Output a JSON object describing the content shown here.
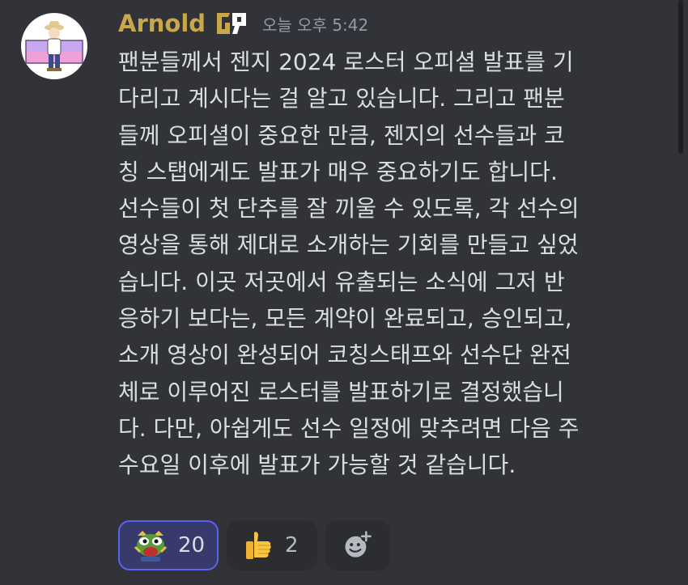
{
  "author": {
    "name": "Arnold",
    "badge_icon": "gen-g-badge-icon",
    "timestamp": "오늘 오후 5:42"
  },
  "message": {
    "lines": [
      "팬분들께서 젠지 2024 로스터 오피셜 발표를 기",
      "다리고 계시다는 걸 알고 있습니다. 그리고 팬분",
      "들께 오피셜이 중요한 만큼, 젠지의 선수들과 코",
      "칭 스탭에게도 발표가 매우 중요하기도 합니다.",
      "선수들이 첫 단추를 잘 끼울 수 있도록, 각 선수의",
      "영상을 통해 제대로 소개하는 기회를 만들고 싶었",
      "습니다. 이곳 저곳에서 유출되는 소식에 그저 반",
      "응하기 보다는, 모든 계약이 완료되고, 승인되고,",
      "소개 영상이 완성되어 코칭스태프와 선수단 완전",
      "체로 이루어진 로스터를 발표하기로 결정했습니",
      "다. 다만, 아쉽게도 선수 일정에 맞추려면 다음 주",
      "수요일 이후에 발표가 가능할 것 같습니다."
    ]
  },
  "reactions": [
    {
      "emoji_icon": "pepe-cheer-icon",
      "count": "20",
      "active": true
    },
    {
      "emoji_icon": "thumbs-up-icon",
      "count": "2",
      "active": false
    }
  ],
  "add_reaction_icon": "add-reaction-icon",
  "colors": {
    "background": "#313338",
    "username": "#c8a84a",
    "text": "#dbdee1",
    "timestamp": "#949ba4",
    "active_reaction_bg": "#373a6b",
    "active_reaction_border": "#5865f2",
    "reaction_bg": "#2b2d31"
  }
}
